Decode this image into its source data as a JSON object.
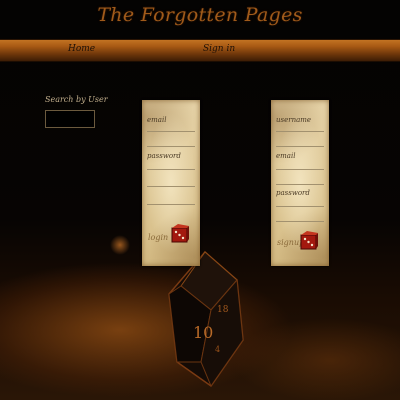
{
  "site": {
    "title": "The Forgotten Pages"
  },
  "nav": {
    "home": "Home",
    "signin": "Sign in"
  },
  "search": {
    "label": "Search by User",
    "value": "",
    "placeholder": ""
  },
  "login_form": {
    "email_label": "email",
    "password_label": "password",
    "submit_label": "login",
    "submit_icon": "dice-icon"
  },
  "signup_form": {
    "username_label": "username",
    "email_label": "email",
    "password_label": "password",
    "submit_label": "signup",
    "submit_icon": "dice-icon"
  },
  "colors": {
    "title": "#a05a1a",
    "nav_bar": "#a85a14",
    "parchment": "#e1cc9c",
    "icon_red": "#a3190f"
  }
}
